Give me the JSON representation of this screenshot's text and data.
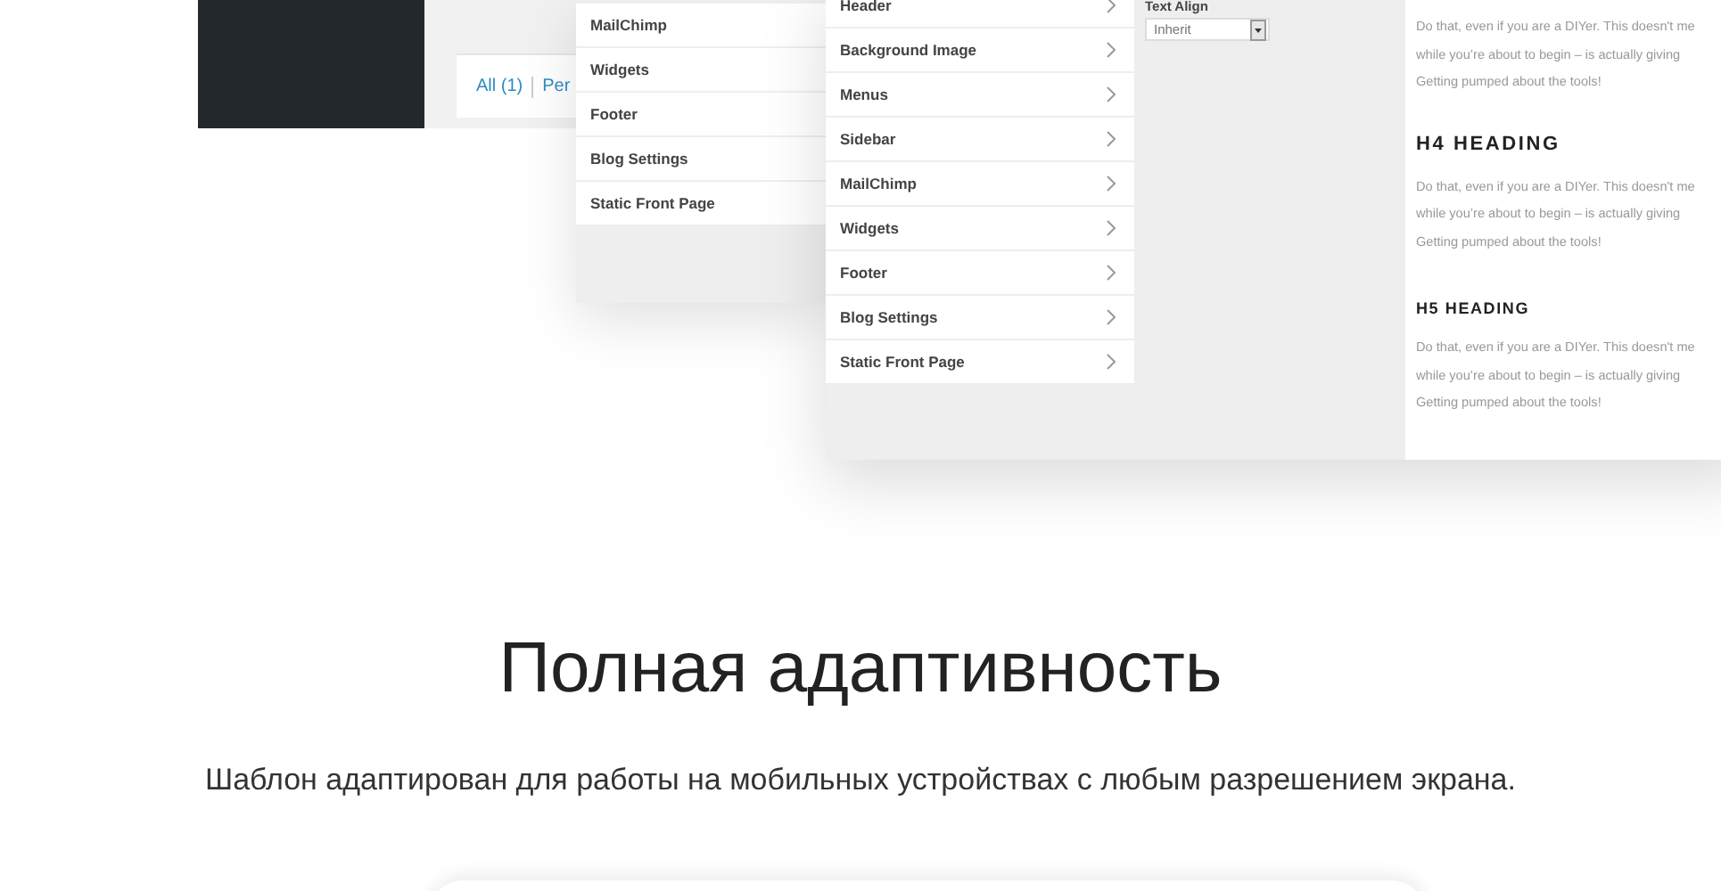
{
  "back_panel": {
    "filter_links": [
      {
        "label": "All (1)"
      },
      {
        "label": "Per"
      }
    ]
  },
  "middle_panel": {
    "menu_items": [
      {
        "label": "MailChimp"
      },
      {
        "label": "Widgets"
      },
      {
        "label": "Footer"
      },
      {
        "label": "Blog Settings"
      },
      {
        "label": "Static Front Page"
      }
    ]
  },
  "front_panel": {
    "menu_items": [
      {
        "label": "Header"
      },
      {
        "label": "Background Image"
      },
      {
        "label": "Menus"
      },
      {
        "label": "Sidebar"
      },
      {
        "label": "MailChimp"
      },
      {
        "label": "Widgets"
      },
      {
        "label": "Footer"
      },
      {
        "label": "Blog Settings"
      },
      {
        "label": "Static Front Page"
      }
    ],
    "field": {
      "label": "Text Align",
      "value": "Inherit"
    },
    "preview": [
      {
        "kind": "paragraph",
        "lines": [
          "Do that, even if you are a DIYer. This doesn't me",
          "while you’re about to begin – is actually giving",
          "Getting pumped about the tools!"
        ]
      },
      {
        "kind": "h4",
        "text": "H4 HEADING"
      },
      {
        "kind": "paragraph",
        "lines": [
          "Do that, even if you are a DIYer. This doesn't me",
          "while you’re about to begin – is actually giving",
          "Getting pumped about the tools!"
        ]
      },
      {
        "kind": "h5",
        "text": "H5 HEADING"
      },
      {
        "kind": "paragraph",
        "lines": [
          "Do that, even if you are a DIYer. This doesn't me",
          "while you’re about to begin – is actually giving",
          "Getting pumped about the tools!"
        ]
      }
    ]
  },
  "section": {
    "title": "Полная адаптивность",
    "description": "Шаблон адаптирован для работы на мобильных устройствах с любым разрешением экрана."
  }
}
